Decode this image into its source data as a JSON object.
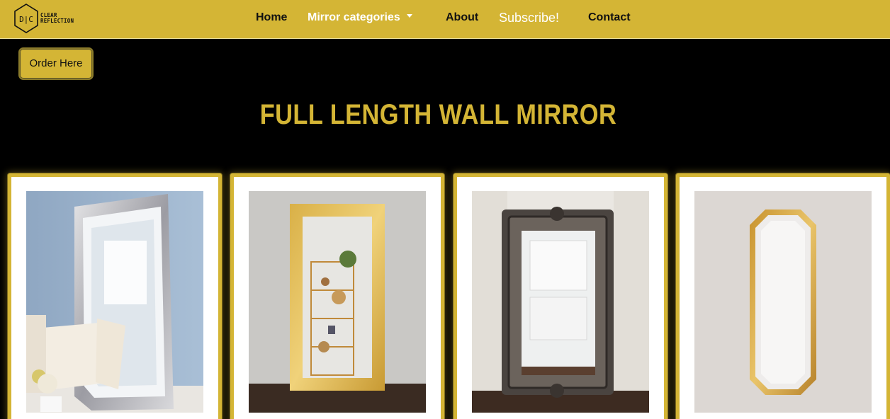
{
  "brand": {
    "name_line1": "CLEAR",
    "name_line2": "REFLECTION",
    "mark": "D|C"
  },
  "nav": {
    "home": "Home",
    "categories": "Mirror categories",
    "about": "About",
    "subscribe": "Subscribe!",
    "contact": "Contact"
  },
  "order_button": "Order Here",
  "page_title": "FULL LENGTH WALL MIRROR",
  "colors": {
    "accent": "#d4b535",
    "background": "#000000",
    "card": "#ffffff"
  },
  "icons": {
    "logo": "hexagon-logo-icon",
    "dropdown": "chevron-down-icon"
  },
  "products": [
    {
      "image": "mirror-venetian-beveled-image"
    },
    {
      "image": "mirror-gold-leaf-image"
    },
    {
      "image": "mirror-baroque-ornate-image"
    },
    {
      "image": "mirror-gold-octagonal-image"
    }
  ]
}
